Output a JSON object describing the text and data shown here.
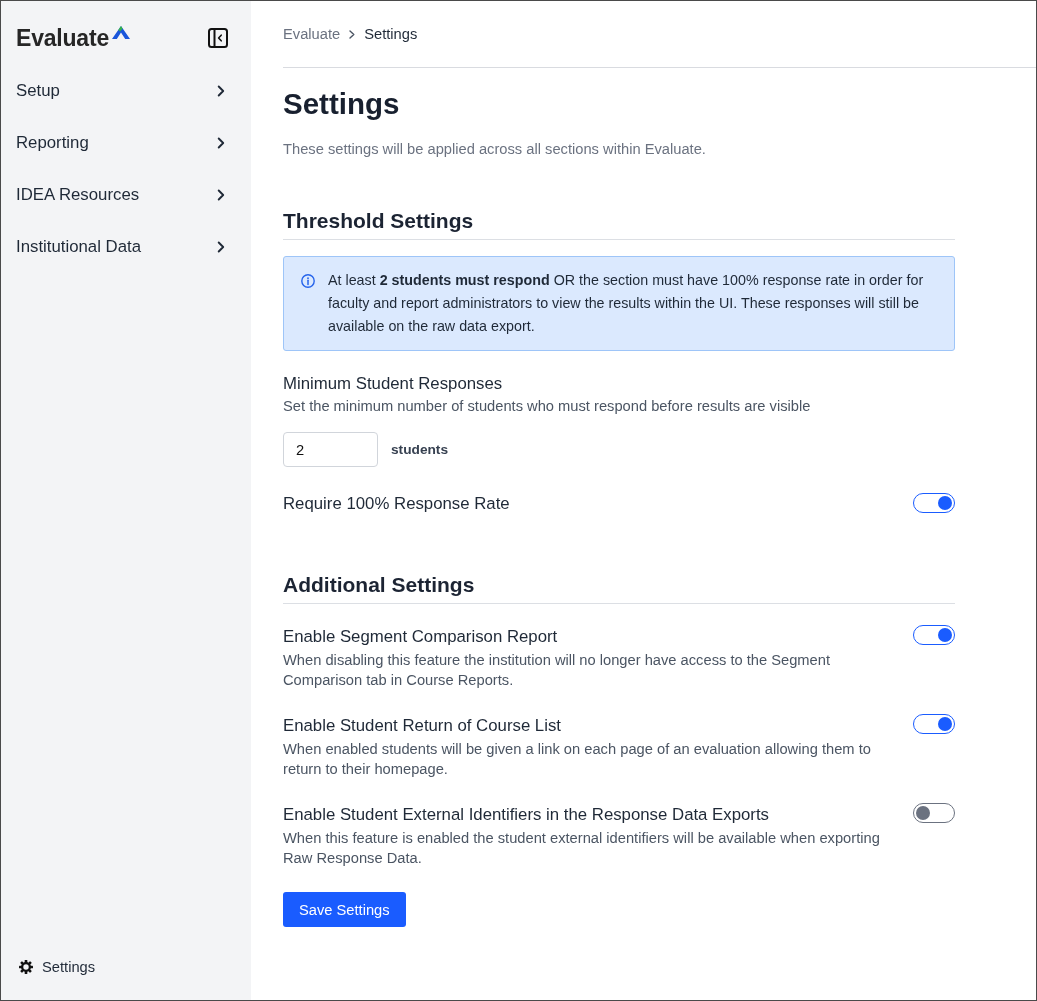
{
  "sidebar": {
    "logo": "Evaluate",
    "items": [
      {
        "label": "Setup"
      },
      {
        "label": "Reporting"
      },
      {
        "label": "IDEA Resources"
      },
      {
        "label": "Institutional Data"
      }
    ],
    "footer_link": "Settings"
  },
  "breadcrumb": [
    {
      "label": "Evaluate",
      "current": false
    },
    {
      "label": "Settings",
      "current": true
    }
  ],
  "page": {
    "title": "Settings",
    "description": "These settings will be applied across all sections within Evaluate."
  },
  "sections": [
    {
      "title": "Threshold Settings",
      "items": [
        {
          "kind": "notice",
          "text": "At least **2 students must respond** OR the section must have 100% response rate in order for faculty and report administrators to view the results within the UI. These responses will still be available on the raw data export."
        },
        {
          "kind": "number",
          "label": "Minimum Student Responses",
          "description": "Set the minimum number of students who must respond before results are visible",
          "value": "2",
          "unit": "students"
        },
        {
          "kind": "toggle",
          "label": "Require 100% Response Rate",
          "on": true
        }
      ]
    },
    {
      "title": "Additional Settings",
      "items": [
        {
          "kind": "toggle",
          "label": "Enable Segment Comparison Report",
          "description": "When disabling this feature the institution will no longer have access to the Segment Comparison tab in Course Reports.",
          "on": true
        },
        {
          "kind": "toggle",
          "label": "Enable Student Return of Course List",
          "description": "When enabled students will be given a link on each page of an evaluation allowing them to return to their homepage.",
          "on": true
        },
        {
          "kind": "toggle",
          "label": "Enable Student External Identifiers in the Response Data Exports",
          "description": "When this feature is enabled the student external identifiers will be available when exporting Raw Response Data.",
          "on": false
        }
      ]
    }
  ],
  "save_button": "Save Settings"
}
